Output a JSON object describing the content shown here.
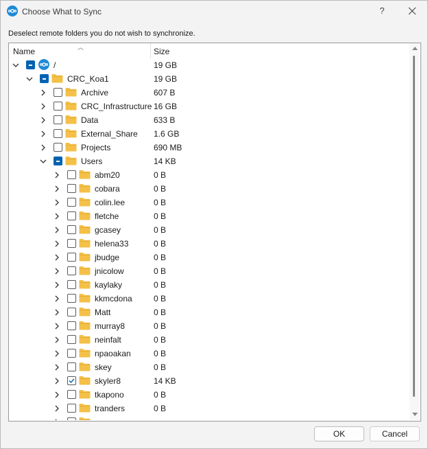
{
  "window": {
    "title": "Choose What to Sync",
    "help": "?"
  },
  "description": "Deselect remote folders you do not wish to synchronize.",
  "columns": {
    "name": "Name",
    "size": "Size"
  },
  "rows": [
    {
      "name": "/",
      "size": "19 GB",
      "level": 0,
      "expanded": true,
      "check": "partial",
      "icon": "nextcloud"
    },
    {
      "name": "CRC_Koa1",
      "size": "19 GB",
      "level": 1,
      "expanded": true,
      "check": "partial",
      "icon": "folder"
    },
    {
      "name": "Archive",
      "size": "607 B",
      "level": 2,
      "expanded": false,
      "check": "unchecked",
      "icon": "folder"
    },
    {
      "name": "CRC_Infrastructure",
      "size": "16 GB",
      "level": 2,
      "expanded": false,
      "check": "unchecked",
      "icon": "folder"
    },
    {
      "name": "Data",
      "size": "633 B",
      "level": 2,
      "expanded": false,
      "check": "unchecked",
      "icon": "folder"
    },
    {
      "name": "External_Share",
      "size": "1.6 GB",
      "level": 2,
      "expanded": false,
      "check": "unchecked",
      "icon": "folder"
    },
    {
      "name": "Projects",
      "size": "690 MB",
      "level": 2,
      "expanded": false,
      "check": "unchecked",
      "icon": "folder"
    },
    {
      "name": "Users",
      "size": "14 KB",
      "level": 2,
      "expanded": true,
      "check": "partial",
      "icon": "folder"
    },
    {
      "name": "abm20",
      "size": "0 B",
      "level": 3,
      "expanded": false,
      "check": "unchecked",
      "icon": "folder"
    },
    {
      "name": "cobara",
      "size": "0 B",
      "level": 3,
      "expanded": false,
      "check": "unchecked",
      "icon": "folder"
    },
    {
      "name": "colin.lee",
      "size": "0 B",
      "level": 3,
      "expanded": false,
      "check": "unchecked",
      "icon": "folder"
    },
    {
      "name": "fletche",
      "size": "0 B",
      "level": 3,
      "expanded": false,
      "check": "unchecked",
      "icon": "folder"
    },
    {
      "name": "gcasey",
      "size": "0 B",
      "level": 3,
      "expanded": false,
      "check": "unchecked",
      "icon": "folder"
    },
    {
      "name": "helena33",
      "size": "0 B",
      "level": 3,
      "expanded": false,
      "check": "unchecked",
      "icon": "folder"
    },
    {
      "name": "jbudge",
      "size": "0 B",
      "level": 3,
      "expanded": false,
      "check": "unchecked",
      "icon": "folder"
    },
    {
      "name": "jnicolow",
      "size": "0 B",
      "level": 3,
      "expanded": false,
      "check": "unchecked",
      "icon": "folder"
    },
    {
      "name": "kaylaky",
      "size": "0 B",
      "level": 3,
      "expanded": false,
      "check": "unchecked",
      "icon": "folder"
    },
    {
      "name": "kkmcdona",
      "size": "0 B",
      "level": 3,
      "expanded": false,
      "check": "unchecked",
      "icon": "folder"
    },
    {
      "name": "Matt",
      "size": "0 B",
      "level": 3,
      "expanded": false,
      "check": "unchecked",
      "icon": "folder"
    },
    {
      "name": "murray8",
      "size": "0 B",
      "level": 3,
      "expanded": false,
      "check": "unchecked",
      "icon": "folder"
    },
    {
      "name": "neinfalt",
      "size": "0 B",
      "level": 3,
      "expanded": false,
      "check": "unchecked",
      "icon": "folder"
    },
    {
      "name": "npaoakan",
      "size": "0 B",
      "level": 3,
      "expanded": false,
      "check": "unchecked",
      "icon": "folder"
    },
    {
      "name": "skey",
      "size": "0 B",
      "level": 3,
      "expanded": false,
      "check": "unchecked",
      "icon": "folder"
    },
    {
      "name": "skyler8",
      "size": "14 KB",
      "level": 3,
      "expanded": false,
      "check": "checked",
      "icon": "folder"
    },
    {
      "name": "tkapono",
      "size": "0 B",
      "level": 3,
      "expanded": false,
      "check": "unchecked",
      "icon": "folder"
    },
    {
      "name": "tranders",
      "size": "0 B",
      "level": 3,
      "expanded": false,
      "check": "unchecked",
      "icon": "folder"
    },
    {
      "name": "",
      "size": "",
      "level": 3,
      "expanded": false,
      "check": "unchecked",
      "icon": "folder"
    }
  ],
  "buttons": {
    "ok": "OK",
    "cancel": "Cancel"
  },
  "colors": {
    "accent": "#0063b1",
    "folder": "#f4c048",
    "nextcloud": "#1f8ad6"
  }
}
